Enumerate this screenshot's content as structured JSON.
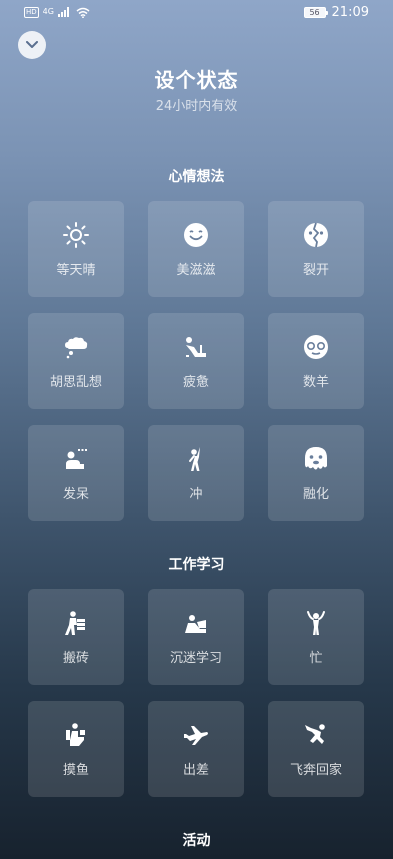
{
  "status_bar": {
    "hd": "HD",
    "network": "4G",
    "battery": "56",
    "time": "21:09"
  },
  "header": {
    "title": "设个状态",
    "subtitle": "24小时内有效"
  },
  "sections": [
    {
      "title": "心情想法",
      "items": [
        {
          "label": "等天晴",
          "icon": "sun-icon"
        },
        {
          "label": "美滋滋",
          "icon": "smiley-icon"
        },
        {
          "label": "裂开",
          "icon": "cracked-face-icon"
        },
        {
          "label": "胡思乱想",
          "icon": "thought-bubble-icon"
        },
        {
          "label": "疲惫",
          "icon": "slumped-person-icon"
        },
        {
          "label": "数羊",
          "icon": "sheep-face-icon"
        },
        {
          "label": "发呆",
          "icon": "sitting-daze-icon"
        },
        {
          "label": "冲",
          "icon": "raised-fist-person-icon"
        },
        {
          "label": "融化",
          "icon": "melting-face-icon"
        }
      ]
    },
    {
      "title": "工作学习",
      "items": [
        {
          "label": "搬砖",
          "icon": "carrying-bricks-icon"
        },
        {
          "label": "沉迷学习",
          "icon": "studying-person-icon"
        },
        {
          "label": "忙",
          "icon": "busy-person-icon"
        },
        {
          "label": "摸鱼",
          "icon": "toilet-person-icon"
        },
        {
          "label": "出差",
          "icon": "airplane-icon"
        },
        {
          "label": "飞奔回家",
          "icon": "running-home-icon"
        }
      ]
    },
    {
      "title": "活动",
      "items": []
    }
  ]
}
